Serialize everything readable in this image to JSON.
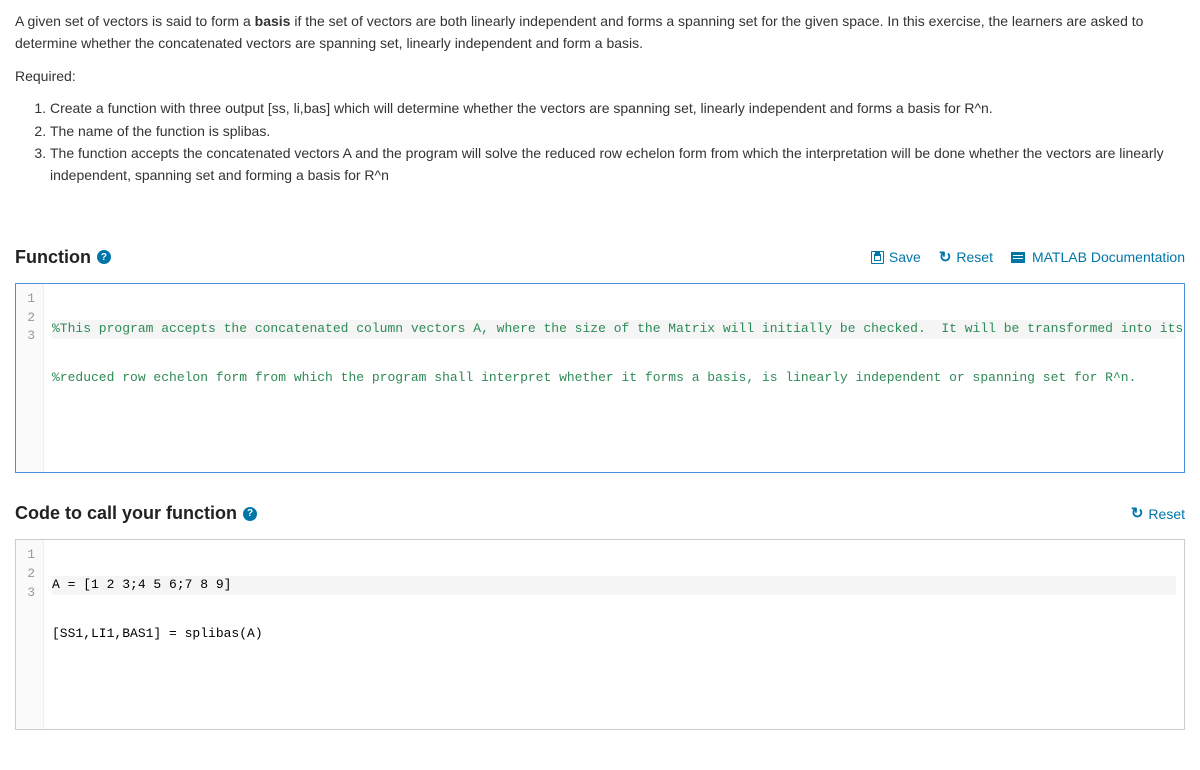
{
  "intro": {
    "part1": "A given set of vectors is said to form a ",
    "bold": "basis",
    "part2": " if the set of vectors are both linearly independent and forms a spanning set for the given space.  In this exercise, the learners are asked to determine whether the concatenated vectors are spanning set, linearly independent and form a basis."
  },
  "required_label": "Required:",
  "requirements": [
    "Create a function with three output [ss, li,bas] which will determine whether the vectors are spanning set, linearly independent and forms a basis for R^n.",
    "The name of the function is splibas.",
    "The function accepts the concatenated vectors A and the program will solve the reduced row echelon form from which the interpretation will be done whether the vectors are linearly independent, spanning set and forming a basis for R^n"
  ],
  "function": {
    "title": "Function",
    "toolbar": {
      "save": "Save",
      "reset": "Reset",
      "docs": "MATLAB Documentation"
    },
    "lines": [
      "1",
      "2",
      "3"
    ],
    "code": {
      "l1": "%This program accepts the concatenated column vectors A, where the size of the Matrix will initially be checked.  It will be transformed into its",
      "l2": "%reduced row echelon form from which the program shall interpret whether it forms a basis, is linearly independent or spanning set for R^n.",
      "l3": ""
    }
  },
  "caller": {
    "title": "Code to call your function",
    "reset": "Reset",
    "lines": [
      "1",
      "2",
      "3"
    ],
    "code": {
      "l1": "A = [1 2 3;4 5 6;7 8 9]",
      "l2": "[SS1,LI1,BAS1] = splibas(A)",
      "l3": ""
    }
  }
}
